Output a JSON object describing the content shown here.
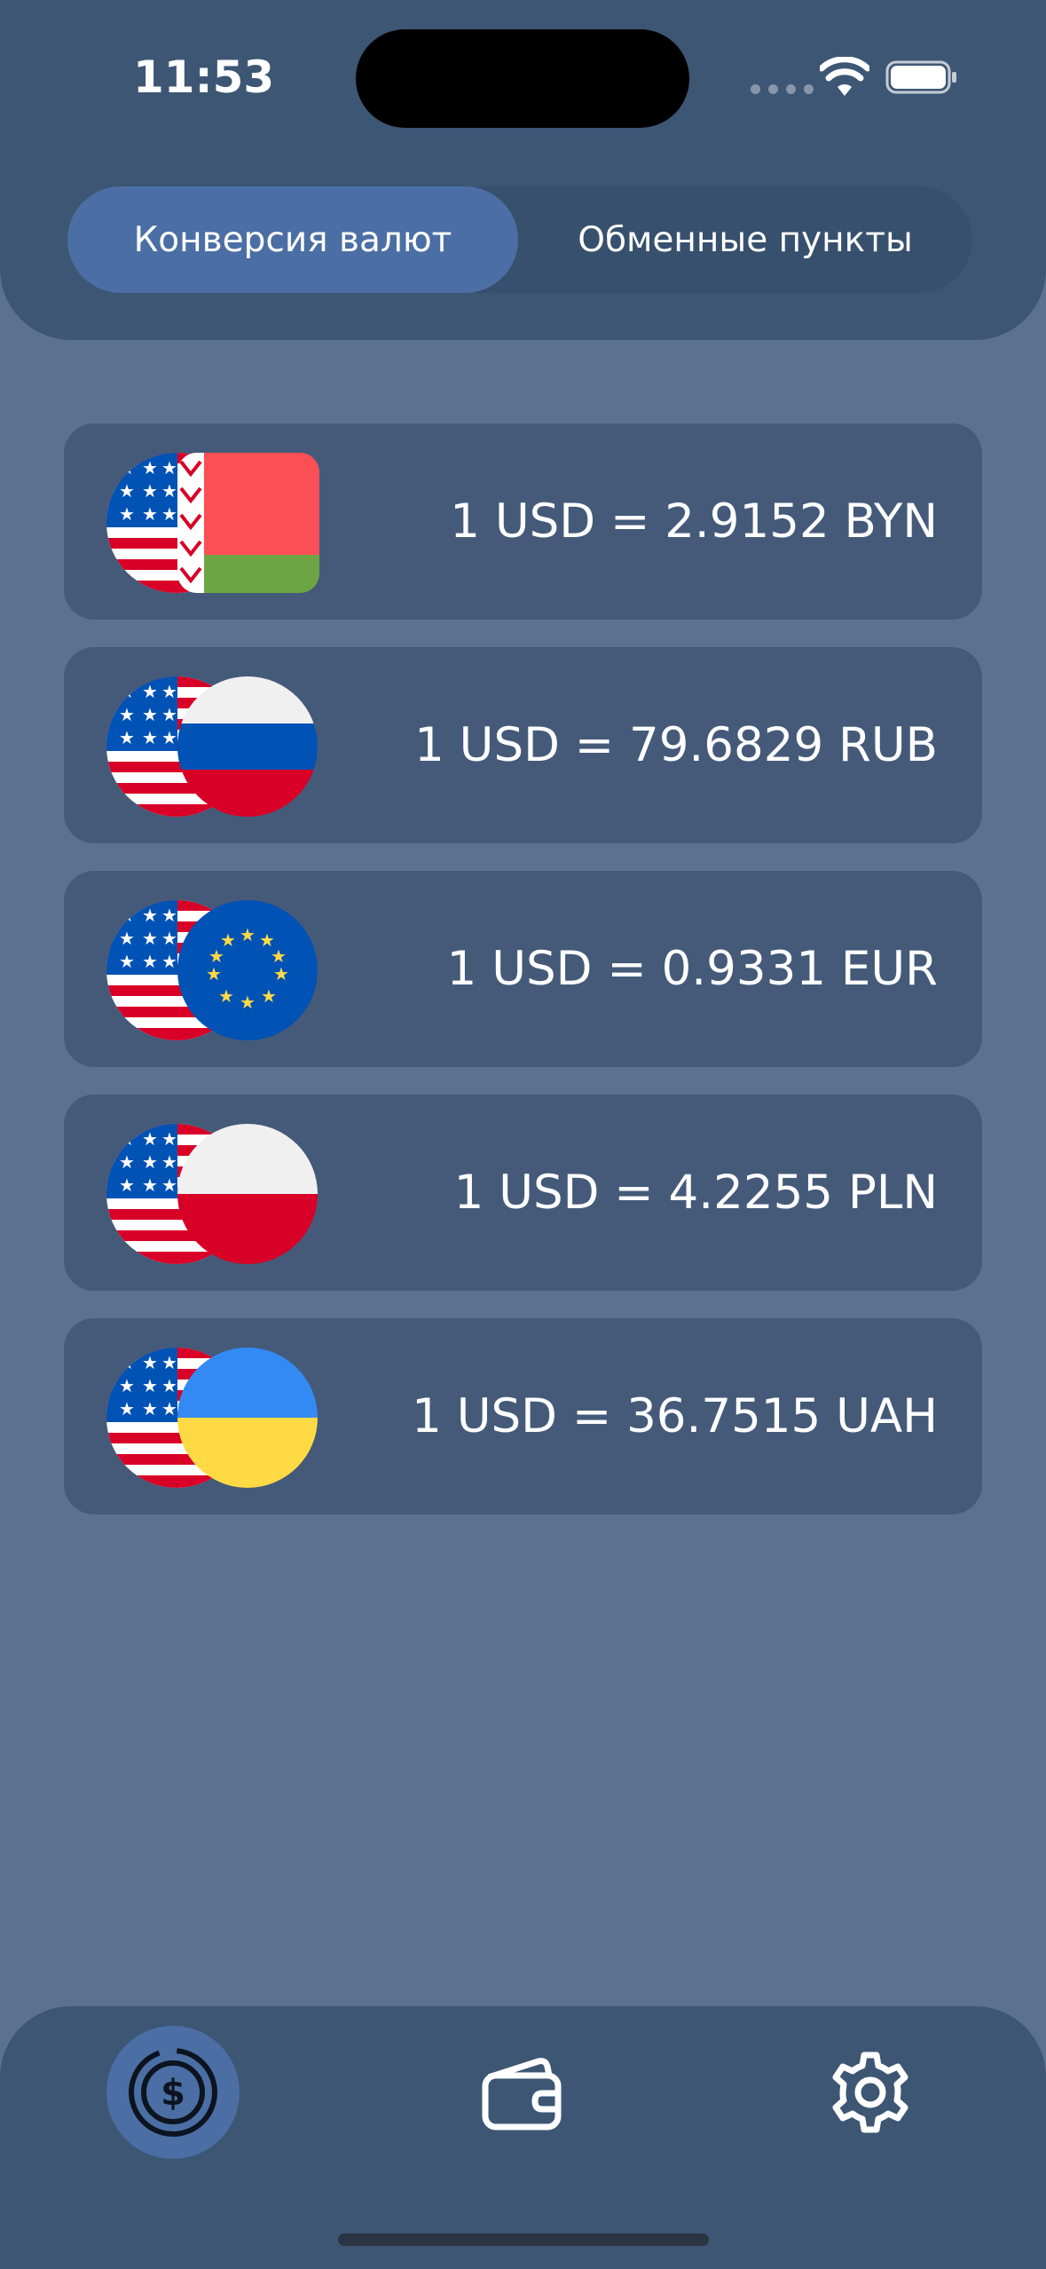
{
  "status_bar": {
    "time": "11:53",
    "icons": [
      "signal-dots-icon",
      "wifi-icon",
      "battery-icon"
    ]
  },
  "segmented_control": {
    "options": [
      {
        "label": "Конверсия валют",
        "selected": true
      },
      {
        "label": "Обменные пункты",
        "selected": false
      }
    ]
  },
  "rates": [
    {
      "base_flag": "us-flag-icon",
      "quote_flag": "by-flag-icon",
      "text": "1 USD = 2.9152 BYN"
    },
    {
      "base_flag": "us-flag-icon",
      "quote_flag": "ru-flag-icon",
      "text": "1 USD = 79.6829 RUB"
    },
    {
      "base_flag": "us-flag-icon",
      "quote_flag": "eu-flag-icon",
      "text": "1 USD = 0.9331 EUR"
    },
    {
      "base_flag": "us-flag-icon",
      "quote_flag": "pl-flag-icon",
      "text": "1 USD = 4.2255 PLN"
    },
    {
      "base_flag": "us-flag-icon",
      "quote_flag": "ua-flag-icon",
      "text": "1 USD = 36.7515 UAH"
    }
  ],
  "tab_bar": {
    "tabs": [
      {
        "icon": "dollar-coin-icon",
        "selected": true
      },
      {
        "icon": "wallet-icon",
        "selected": false
      },
      {
        "icon": "gear-icon",
        "selected": false
      }
    ]
  },
  "colors": {
    "background": "#5c718d",
    "panel": "#3d5674",
    "card": "#455a79",
    "accent": "#4b6fa4"
  }
}
